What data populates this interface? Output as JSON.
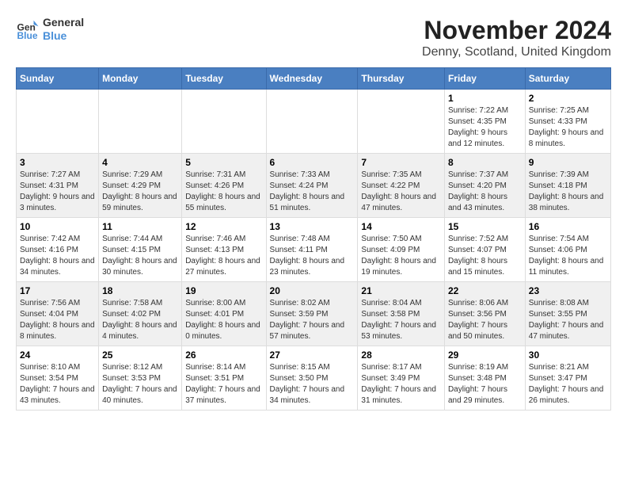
{
  "header": {
    "logo": {
      "line1": "General",
      "line2": "Blue"
    },
    "title": "November 2024",
    "subtitle": "Denny, Scotland, United Kingdom"
  },
  "weekdays": [
    "Sunday",
    "Monday",
    "Tuesday",
    "Wednesday",
    "Thursday",
    "Friday",
    "Saturday"
  ],
  "weeks": [
    [
      {
        "day": "",
        "sunrise": "",
        "sunset": "",
        "daylight": ""
      },
      {
        "day": "",
        "sunrise": "",
        "sunset": "",
        "daylight": ""
      },
      {
        "day": "",
        "sunrise": "",
        "sunset": "",
        "daylight": ""
      },
      {
        "day": "",
        "sunrise": "",
        "sunset": "",
        "daylight": ""
      },
      {
        "day": "",
        "sunrise": "",
        "sunset": "",
        "daylight": ""
      },
      {
        "day": "1",
        "sunrise": "Sunrise: 7:22 AM",
        "sunset": "Sunset: 4:35 PM",
        "daylight": "Daylight: 9 hours and 12 minutes."
      },
      {
        "day": "2",
        "sunrise": "Sunrise: 7:25 AM",
        "sunset": "Sunset: 4:33 PM",
        "daylight": "Daylight: 9 hours and 8 minutes."
      }
    ],
    [
      {
        "day": "3",
        "sunrise": "Sunrise: 7:27 AM",
        "sunset": "Sunset: 4:31 PM",
        "daylight": "Daylight: 9 hours and 3 minutes."
      },
      {
        "day": "4",
        "sunrise": "Sunrise: 7:29 AM",
        "sunset": "Sunset: 4:29 PM",
        "daylight": "Daylight: 8 hours and 59 minutes."
      },
      {
        "day": "5",
        "sunrise": "Sunrise: 7:31 AM",
        "sunset": "Sunset: 4:26 PM",
        "daylight": "Daylight: 8 hours and 55 minutes."
      },
      {
        "day": "6",
        "sunrise": "Sunrise: 7:33 AM",
        "sunset": "Sunset: 4:24 PM",
        "daylight": "Daylight: 8 hours and 51 minutes."
      },
      {
        "day": "7",
        "sunrise": "Sunrise: 7:35 AM",
        "sunset": "Sunset: 4:22 PM",
        "daylight": "Daylight: 8 hours and 47 minutes."
      },
      {
        "day": "8",
        "sunrise": "Sunrise: 7:37 AM",
        "sunset": "Sunset: 4:20 PM",
        "daylight": "Daylight: 8 hours and 43 minutes."
      },
      {
        "day": "9",
        "sunrise": "Sunrise: 7:39 AM",
        "sunset": "Sunset: 4:18 PM",
        "daylight": "Daylight: 8 hours and 38 minutes."
      }
    ],
    [
      {
        "day": "10",
        "sunrise": "Sunrise: 7:42 AM",
        "sunset": "Sunset: 4:16 PM",
        "daylight": "Daylight: 8 hours and 34 minutes."
      },
      {
        "day": "11",
        "sunrise": "Sunrise: 7:44 AM",
        "sunset": "Sunset: 4:15 PM",
        "daylight": "Daylight: 8 hours and 30 minutes."
      },
      {
        "day": "12",
        "sunrise": "Sunrise: 7:46 AM",
        "sunset": "Sunset: 4:13 PM",
        "daylight": "Daylight: 8 hours and 27 minutes."
      },
      {
        "day": "13",
        "sunrise": "Sunrise: 7:48 AM",
        "sunset": "Sunset: 4:11 PM",
        "daylight": "Daylight: 8 hours and 23 minutes."
      },
      {
        "day": "14",
        "sunrise": "Sunrise: 7:50 AM",
        "sunset": "Sunset: 4:09 PM",
        "daylight": "Daylight: 8 hours and 19 minutes."
      },
      {
        "day": "15",
        "sunrise": "Sunrise: 7:52 AM",
        "sunset": "Sunset: 4:07 PM",
        "daylight": "Daylight: 8 hours and 15 minutes."
      },
      {
        "day": "16",
        "sunrise": "Sunrise: 7:54 AM",
        "sunset": "Sunset: 4:06 PM",
        "daylight": "Daylight: 8 hours and 11 minutes."
      }
    ],
    [
      {
        "day": "17",
        "sunrise": "Sunrise: 7:56 AM",
        "sunset": "Sunset: 4:04 PM",
        "daylight": "Daylight: 8 hours and 8 minutes."
      },
      {
        "day": "18",
        "sunrise": "Sunrise: 7:58 AM",
        "sunset": "Sunset: 4:02 PM",
        "daylight": "Daylight: 8 hours and 4 minutes."
      },
      {
        "day": "19",
        "sunrise": "Sunrise: 8:00 AM",
        "sunset": "Sunset: 4:01 PM",
        "daylight": "Daylight: 8 hours and 0 minutes."
      },
      {
        "day": "20",
        "sunrise": "Sunrise: 8:02 AM",
        "sunset": "Sunset: 3:59 PM",
        "daylight": "Daylight: 7 hours and 57 minutes."
      },
      {
        "day": "21",
        "sunrise": "Sunrise: 8:04 AM",
        "sunset": "Sunset: 3:58 PM",
        "daylight": "Daylight: 7 hours and 53 minutes."
      },
      {
        "day": "22",
        "sunrise": "Sunrise: 8:06 AM",
        "sunset": "Sunset: 3:56 PM",
        "daylight": "Daylight: 7 hours and 50 minutes."
      },
      {
        "day": "23",
        "sunrise": "Sunrise: 8:08 AM",
        "sunset": "Sunset: 3:55 PM",
        "daylight": "Daylight: 7 hours and 47 minutes."
      }
    ],
    [
      {
        "day": "24",
        "sunrise": "Sunrise: 8:10 AM",
        "sunset": "Sunset: 3:54 PM",
        "daylight": "Daylight: 7 hours and 43 minutes."
      },
      {
        "day": "25",
        "sunrise": "Sunrise: 8:12 AM",
        "sunset": "Sunset: 3:53 PM",
        "daylight": "Daylight: 7 hours and 40 minutes."
      },
      {
        "day": "26",
        "sunrise": "Sunrise: 8:14 AM",
        "sunset": "Sunset: 3:51 PM",
        "daylight": "Daylight: 7 hours and 37 minutes."
      },
      {
        "day": "27",
        "sunrise": "Sunrise: 8:15 AM",
        "sunset": "Sunset: 3:50 PM",
        "daylight": "Daylight: 7 hours and 34 minutes."
      },
      {
        "day": "28",
        "sunrise": "Sunrise: 8:17 AM",
        "sunset": "Sunset: 3:49 PM",
        "daylight": "Daylight: 7 hours and 31 minutes."
      },
      {
        "day": "29",
        "sunrise": "Sunrise: 8:19 AM",
        "sunset": "Sunset: 3:48 PM",
        "daylight": "Daylight: 7 hours and 29 minutes."
      },
      {
        "day": "30",
        "sunrise": "Sunrise: 8:21 AM",
        "sunset": "Sunset: 3:47 PM",
        "daylight": "Daylight: 7 hours and 26 minutes."
      }
    ]
  ]
}
